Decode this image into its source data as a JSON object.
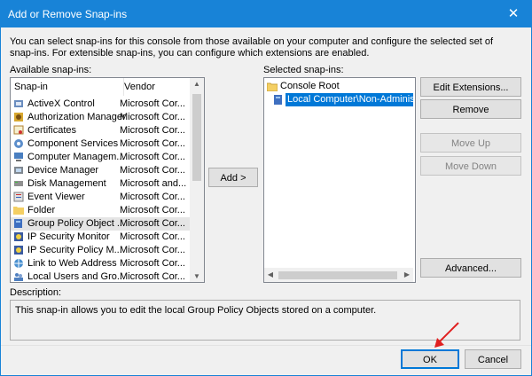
{
  "window": {
    "title": "Add or Remove Snap-ins",
    "close_glyph": "✕"
  },
  "intro": "You can select snap-ins for this console from those available on your computer and configure the selected set of snap-ins. For extensible snap-ins, you can configure which extensions are enabled.",
  "available": {
    "label": "Available snap-ins:",
    "columns": [
      "Snap-in",
      "Vendor"
    ],
    "rows": [
      {
        "name": "ActiveX Control",
        "vendor": "Microsoft Cor...",
        "icon": "activex-icon"
      },
      {
        "name": "Authorization Manager",
        "vendor": "Microsoft Cor...",
        "icon": "authorization-icon"
      },
      {
        "name": "Certificates",
        "vendor": "Microsoft Cor...",
        "icon": "certificate-icon"
      },
      {
        "name": "Component Services",
        "vendor": "Microsoft Cor...",
        "icon": "component-services-icon"
      },
      {
        "name": "Computer Managem...",
        "vendor": "Microsoft Cor...",
        "icon": "computer-icon"
      },
      {
        "name": "Device Manager",
        "vendor": "Microsoft Cor...",
        "icon": "device-manager-icon"
      },
      {
        "name": "Disk Management",
        "vendor": "Microsoft and...",
        "icon": "disk-icon"
      },
      {
        "name": "Event Viewer",
        "vendor": "Microsoft Cor...",
        "icon": "event-viewer-icon"
      },
      {
        "name": "Folder",
        "vendor": "Microsoft Cor...",
        "icon": "folder-icon"
      },
      {
        "name": "Group Policy Object ...",
        "vendor": "Microsoft Cor...",
        "icon": "group-policy-icon",
        "selected": true
      },
      {
        "name": "IP Security Monitor",
        "vendor": "Microsoft Cor...",
        "icon": "ip-security-icon"
      },
      {
        "name": "IP Security Policy M...",
        "vendor": "Microsoft Cor...",
        "icon": "ip-security-icon"
      },
      {
        "name": "Link to Web Address",
        "vendor": "Microsoft Cor...",
        "icon": "web-link-icon"
      },
      {
        "name": "Local Users and Gro...",
        "vendor": "Microsoft Cor...",
        "icon": "users-icon"
      }
    ]
  },
  "add_button": "Add >",
  "selected": {
    "label": "Selected snap-ins:",
    "root": "Console Root",
    "child": "Local Computer\\Non-Administrat..."
  },
  "right_buttons": {
    "edit_extensions": "Edit Extensions...",
    "remove": "Remove",
    "move_up": "Move Up",
    "move_down": "Move Down",
    "advanced": "Advanced..."
  },
  "description": {
    "label": "Description:",
    "text": "This snap-in allows you to edit the local Group Policy Objects stored on a computer."
  },
  "footer": {
    "ok": "OK",
    "cancel": "Cancel"
  },
  "colors": {
    "accent": "#1883d7",
    "selection": "#0078d7",
    "annotation_arrow": "#e02020"
  }
}
